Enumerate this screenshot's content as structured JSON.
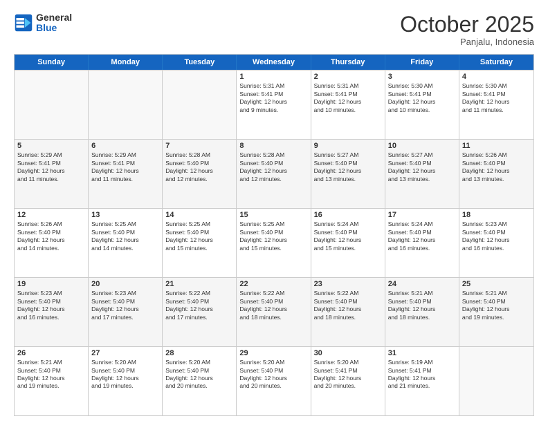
{
  "header": {
    "logo_line1": "General",
    "logo_line2": "Blue",
    "month": "October 2025",
    "location": "Panjalu, Indonesia"
  },
  "days_of_week": [
    "Sunday",
    "Monday",
    "Tuesday",
    "Wednesday",
    "Thursday",
    "Friday",
    "Saturday"
  ],
  "rows": [
    [
      {
        "day": "",
        "text": ""
      },
      {
        "day": "",
        "text": ""
      },
      {
        "day": "",
        "text": ""
      },
      {
        "day": "1",
        "text": "Sunrise: 5:31 AM\nSunset: 5:41 PM\nDaylight: 12 hours\nand 9 minutes."
      },
      {
        "day": "2",
        "text": "Sunrise: 5:31 AM\nSunset: 5:41 PM\nDaylight: 12 hours\nand 10 minutes."
      },
      {
        "day": "3",
        "text": "Sunrise: 5:30 AM\nSunset: 5:41 PM\nDaylight: 12 hours\nand 10 minutes."
      },
      {
        "day": "4",
        "text": "Sunrise: 5:30 AM\nSunset: 5:41 PM\nDaylight: 12 hours\nand 11 minutes."
      }
    ],
    [
      {
        "day": "5",
        "text": "Sunrise: 5:29 AM\nSunset: 5:41 PM\nDaylight: 12 hours\nand 11 minutes."
      },
      {
        "day": "6",
        "text": "Sunrise: 5:29 AM\nSunset: 5:41 PM\nDaylight: 12 hours\nand 11 minutes."
      },
      {
        "day": "7",
        "text": "Sunrise: 5:28 AM\nSunset: 5:40 PM\nDaylight: 12 hours\nand 12 minutes."
      },
      {
        "day": "8",
        "text": "Sunrise: 5:28 AM\nSunset: 5:40 PM\nDaylight: 12 hours\nand 12 minutes."
      },
      {
        "day": "9",
        "text": "Sunrise: 5:27 AM\nSunset: 5:40 PM\nDaylight: 12 hours\nand 13 minutes."
      },
      {
        "day": "10",
        "text": "Sunrise: 5:27 AM\nSunset: 5:40 PM\nDaylight: 12 hours\nand 13 minutes."
      },
      {
        "day": "11",
        "text": "Sunrise: 5:26 AM\nSunset: 5:40 PM\nDaylight: 12 hours\nand 13 minutes."
      }
    ],
    [
      {
        "day": "12",
        "text": "Sunrise: 5:26 AM\nSunset: 5:40 PM\nDaylight: 12 hours\nand 14 minutes."
      },
      {
        "day": "13",
        "text": "Sunrise: 5:25 AM\nSunset: 5:40 PM\nDaylight: 12 hours\nand 14 minutes."
      },
      {
        "day": "14",
        "text": "Sunrise: 5:25 AM\nSunset: 5:40 PM\nDaylight: 12 hours\nand 15 minutes."
      },
      {
        "day": "15",
        "text": "Sunrise: 5:25 AM\nSunset: 5:40 PM\nDaylight: 12 hours\nand 15 minutes."
      },
      {
        "day": "16",
        "text": "Sunrise: 5:24 AM\nSunset: 5:40 PM\nDaylight: 12 hours\nand 15 minutes."
      },
      {
        "day": "17",
        "text": "Sunrise: 5:24 AM\nSunset: 5:40 PM\nDaylight: 12 hours\nand 16 minutes."
      },
      {
        "day": "18",
        "text": "Sunrise: 5:23 AM\nSunset: 5:40 PM\nDaylight: 12 hours\nand 16 minutes."
      }
    ],
    [
      {
        "day": "19",
        "text": "Sunrise: 5:23 AM\nSunset: 5:40 PM\nDaylight: 12 hours\nand 16 minutes."
      },
      {
        "day": "20",
        "text": "Sunrise: 5:23 AM\nSunset: 5:40 PM\nDaylight: 12 hours\nand 17 minutes."
      },
      {
        "day": "21",
        "text": "Sunrise: 5:22 AM\nSunset: 5:40 PM\nDaylight: 12 hours\nand 17 minutes."
      },
      {
        "day": "22",
        "text": "Sunrise: 5:22 AM\nSunset: 5:40 PM\nDaylight: 12 hours\nand 18 minutes."
      },
      {
        "day": "23",
        "text": "Sunrise: 5:22 AM\nSunset: 5:40 PM\nDaylight: 12 hours\nand 18 minutes."
      },
      {
        "day": "24",
        "text": "Sunrise: 5:21 AM\nSunset: 5:40 PM\nDaylight: 12 hours\nand 18 minutes."
      },
      {
        "day": "25",
        "text": "Sunrise: 5:21 AM\nSunset: 5:40 PM\nDaylight: 12 hours\nand 19 minutes."
      }
    ],
    [
      {
        "day": "26",
        "text": "Sunrise: 5:21 AM\nSunset: 5:40 PM\nDaylight: 12 hours\nand 19 minutes."
      },
      {
        "day": "27",
        "text": "Sunrise: 5:20 AM\nSunset: 5:40 PM\nDaylight: 12 hours\nand 19 minutes."
      },
      {
        "day": "28",
        "text": "Sunrise: 5:20 AM\nSunset: 5:40 PM\nDaylight: 12 hours\nand 20 minutes."
      },
      {
        "day": "29",
        "text": "Sunrise: 5:20 AM\nSunset: 5:40 PM\nDaylight: 12 hours\nand 20 minutes."
      },
      {
        "day": "30",
        "text": "Sunrise: 5:20 AM\nSunset: 5:41 PM\nDaylight: 12 hours\nand 20 minutes."
      },
      {
        "day": "31",
        "text": "Sunrise: 5:19 AM\nSunset: 5:41 PM\nDaylight: 12 hours\nand 21 minutes."
      },
      {
        "day": "",
        "text": ""
      }
    ]
  ]
}
